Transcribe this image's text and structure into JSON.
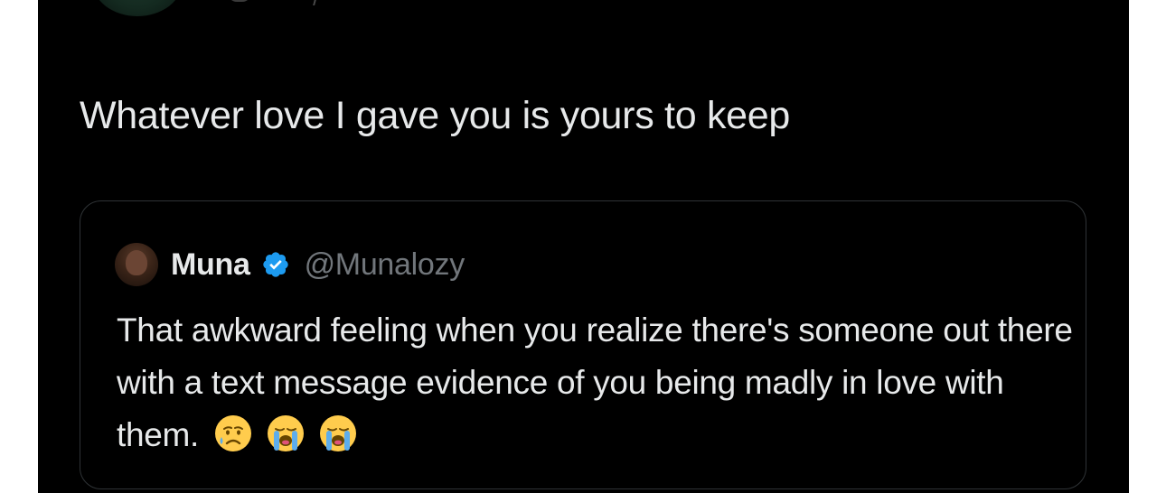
{
  "tweet": {
    "text": "Whatever love I gave you is yours to keep"
  },
  "quoted_tweet": {
    "author_name": "Muna",
    "author_handle": "@Munalozy",
    "text": "That awkward feeling when you realize there's someone out there with a text message evidence of you being madly in love with them.",
    "emojis": [
      "sad-but-relieved-face",
      "loudly-crying-face",
      "loudly-crying-face"
    ]
  },
  "colors": {
    "background": "#000000",
    "text_primary": "#e7e9ea",
    "text_secondary": "#71767b",
    "border": "#2f3336",
    "verified_badge": "#1d9bf0"
  }
}
